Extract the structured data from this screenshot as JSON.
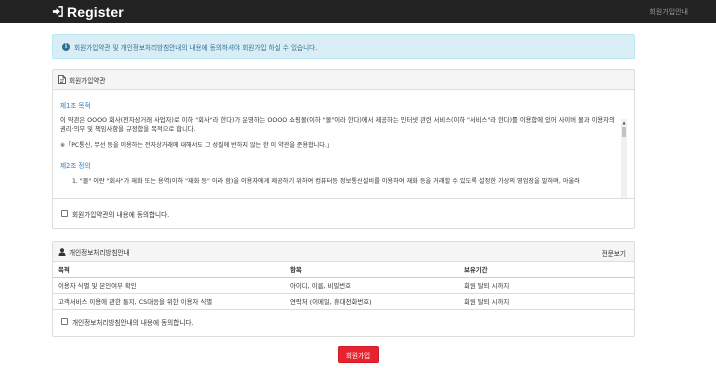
{
  "header": {
    "title": "Register",
    "nav_link": "회원가입안내",
    "icon": "sign-in-icon"
  },
  "alert": {
    "icon": "info-icon",
    "text": "회원가입약관 및 개인정보처리방침안내의 내용에 동의하셔야 회원가입 하실 수 있습니다."
  },
  "terms": {
    "panel_title": "회원가입약관",
    "section1_heading": "제1조 목적",
    "section1_p1": "이 약관은 OOOO 회사(전자상거래 사업자)로 이하 \"회사\"라 한다)가 운영하는 OOOO 쇼핑몰(이하 \"몰\"이라 한다)에서 제공하는 인터넷 관련 서비스(이하 \"서비스\"라 한다)를 이용함에 있어 사이버 몰과 이용자의 권리·의무 및 책임사항을 규정함을 목적으로 합니다.",
    "section1_p2": "※「PC통신, 무선 등을 이용하는 전자상거래에 대해서도 그 성질에 반하지 않는 한 이 약관을 준용합니다.」",
    "section2_heading": "제2조 정의",
    "section2_item1": "1. \"몰\" 이란 \"회사\"가 재화 또는 용역(이하 \"재화 등\" 이라 함)을 이용자에게 제공하기 위하여 컴퓨터등 정보통신설비를 이용하여 재화 등을 거래할 수 있도록 설정한 가상의 영업장을 말하며, 아울러",
    "agree_label": "회원가입약관의 내용에 동의합니다."
  },
  "privacy": {
    "panel_title": "개인정보처리방침안내",
    "view_all": "전문보기",
    "columns": [
      "목적",
      "항목",
      "보유기간"
    ],
    "rows": [
      [
        "이용자 식별 및 본인여부 확인",
        "아이디, 이름, 비밀번호",
        "회원 탈퇴 시까지"
      ],
      [
        "고객서비스 이용에 관한 통지, CS대응을 위한 이용자 식별",
        "연락처 (이메일, 휴대전화번호)",
        "회원 탈퇴 시까지"
      ]
    ],
    "agree_label": "개인정보처리방침안내의 내용에 동의합니다."
  },
  "submit": {
    "label": "회원가입"
  },
  "colors": {
    "topbar": "#222222",
    "alert_bg": "#d9edf7",
    "alert_text": "#31708f",
    "link": "#337ab7",
    "submit": "#e8222e"
  }
}
